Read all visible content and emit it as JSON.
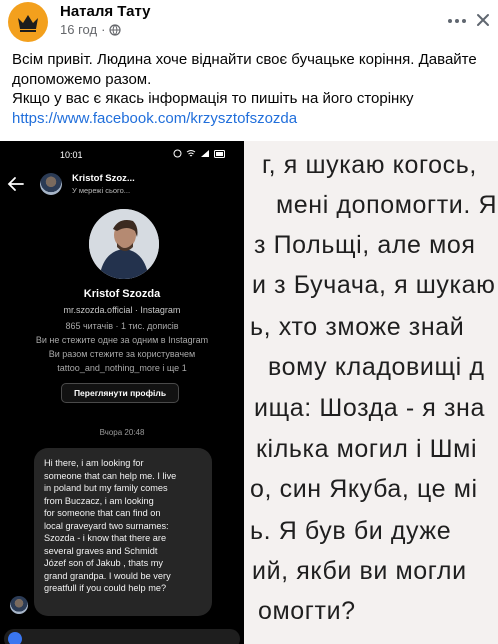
{
  "post": {
    "author": "Наталя Тату",
    "time": "16 год",
    "separator": "·",
    "text_lines": [
      "Всім привіт. Людина хоче віднайти своє бучацьке коріння. Давайте",
      "допоможемо разом.",
      "Якщо у вас є якась інформація то пишіть на його сторінку"
    ],
    "link": "https://www.facebook.com/krzysztofszozda",
    "icons": {
      "avatar": "crown-logo-icon",
      "privacy": "globe-icon",
      "more": "more-dots-icon",
      "close": "close-icon"
    },
    "colors": {
      "link": "#216fdb",
      "avatar_bg": "#f3a01d",
      "meta": "#65676b"
    }
  },
  "phone": {
    "status_time": "10:01",
    "chat_header": {
      "name": "Kristof Szoz...",
      "status": "У мережі сього..."
    },
    "profile": {
      "name": "Kristof Szozda",
      "username": "mr.szozda.official · Instagram",
      "stats": "865 читачів · 1 тис. дописів",
      "info1": "Ви не стежите одне за одним в Instagram",
      "info2": "Ви разом стежите за користувачем",
      "info3": "tattoo_and_nothing_more і ще 1",
      "view_button": "Переглянути профіль"
    },
    "date_stamp": "Вчора 20:48",
    "message_lines": [
      "Hi there, i am looking for",
      "someone that can help me. I live",
      "in poland but my family comes",
      "from Buczacz, i am looking",
      "for someone that can find on",
      "local graveyard two surnames:",
      "Szozda - i know that there are",
      "several graves and Schmidt",
      "Józef son of Jakub , thats my",
      "grand grandpa. I would be very",
      "greatfull if you could help me?"
    ]
  },
  "translation_crop": {
    "lines": [
      "г, я шукаю когось,",
      "мені допомогти. Я",
      "з Польщі, але моя",
      "и з Бучача, я шукаю",
      "ь, хто зможе знай",
      "вому кладовищі д",
      "ища: Шозда - я зна",
      "кілька могил і Шмі",
      "о, син Якуба, це мі",
      "ь. Я був би дуже",
      "ий, якби ви могли",
      "омогти?"
    ]
  }
}
